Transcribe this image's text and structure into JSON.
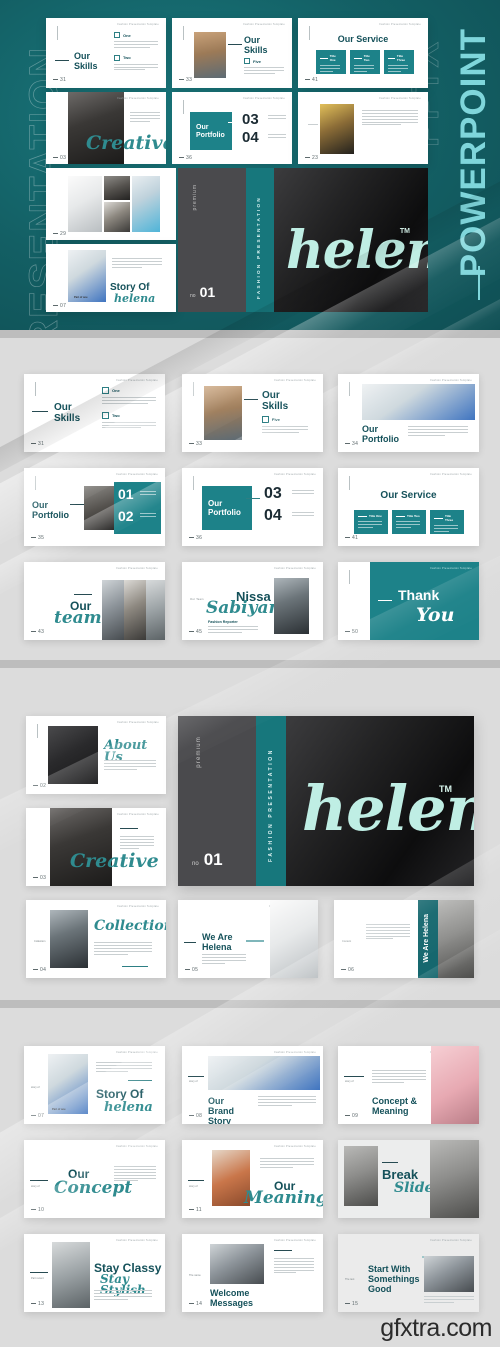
{
  "meta": {
    "watermark": "gfxtra.com",
    "accent_teal": "#1d8289",
    "deep_teal": "#156b70",
    "title_ink": "#15515a",
    "script_mint": "#bfeee4"
  },
  "hero_banner": {
    "vertical_left_outline": "PRESENTATION",
    "vertical_right_outline": "PPTX",
    "vertical_right_solid": "POWERPOINT",
    "slides": [
      {
        "id": "skills-a",
        "number": "31",
        "header": "Fashion Presentation Template",
        "title": "Our Skills",
        "items": [
          "One",
          "Two"
        ]
      },
      {
        "id": "skills-b",
        "number": "33",
        "header": "Fashion Presentation Template",
        "title": "Our Skills",
        "items": [
          "Five"
        ]
      },
      {
        "id": "service",
        "number": "41",
        "header": "Fashion Presentation Template",
        "title": "Our Service",
        "cards": [
          "Title One",
          "Title Two",
          "Title Three"
        ]
      },
      {
        "id": "creative",
        "number": "03",
        "header": "Fashion Presentation Template",
        "script": "Creative"
      },
      {
        "id": "portfolio-b",
        "number": "36",
        "header": "Fashion Presentation Template",
        "title": "Our Portfolio",
        "numbers": [
          "03",
          "04"
        ]
      },
      {
        "id": "yellow",
        "number": "23",
        "header": "Fashion Presentation Template"
      },
      {
        "id": "grid",
        "number": "29",
        "header": "Fashion Presentation Template"
      },
      {
        "id": "story",
        "number": "07",
        "header": "Fashion Presentation Template",
        "title": "Story Of",
        "script": "helena",
        "caption": "Part of one"
      }
    ],
    "cover": {
      "premium_label": "premium",
      "band_label": "FASHION PRESENTATION",
      "no_prefix": "no",
      "no_value": "01",
      "brand": "helena",
      "trademark": "TM"
    }
  },
  "section_2": {
    "slides": [
      {
        "number": "31",
        "header": "Fashion Presentation Template",
        "title": "Our Skills",
        "items": [
          "One",
          "Two"
        ]
      },
      {
        "number": "33",
        "header": "Fashion Presentation Template",
        "title": "Our Skills",
        "items": [
          "Five"
        ]
      },
      {
        "number": "34",
        "header": "Fashion Presentation Template",
        "title": "Our Portfolio"
      },
      {
        "number": "35",
        "header": "Fashion Presentation Template",
        "title": "Our Portfolio",
        "numbers": [
          "01",
          "02"
        ]
      },
      {
        "number": "36",
        "header": "Fashion Presentation Template",
        "title": "Our Portfolio",
        "numbers": [
          "03",
          "04"
        ]
      },
      {
        "number": "41",
        "header": "Fashion Presentation Template",
        "title": "Our Service",
        "cards": [
          "Title One",
          "Title Two",
          "Title Three"
        ]
      },
      {
        "number": "43",
        "header": "Fashion Presentation Template",
        "title": "Our",
        "script": "team",
        "kicker": "Our Team"
      },
      {
        "number": "45",
        "header": "Fashion Presentation Template",
        "title": "Nissa",
        "script": "Sabiyan",
        "subtitle": "Fashion Reporter",
        "kicker": "Our Team"
      },
      {
        "number": "50",
        "header": "Fashion Presentation Template",
        "title": "Thank",
        "script": "You"
      }
    ]
  },
  "section_3": {
    "slides": [
      {
        "number": "02",
        "header": "Fashion Presentation Template",
        "script": "About Us"
      },
      {
        "number": "03",
        "header": "Fashion Presentation Template",
        "script": "Creative"
      },
      {
        "number": "04",
        "header": "Fashion Presentation Template",
        "script": "Collection",
        "kicker": "Collection"
      },
      {
        "number": "05",
        "header": "Fashion Presentation Template",
        "title": "We Are Helena"
      },
      {
        "number": "06",
        "header": "Fashion Presentation Template",
        "title": "We Are Helena",
        "kicker": "Content"
      }
    ],
    "cover": {
      "premium_label": "premium",
      "band_label": "FASHION PRESENTATION",
      "no_prefix": "no",
      "no_value": "01",
      "brand": "helena",
      "trademark": "TM"
    }
  },
  "section_4": {
    "slides": [
      {
        "number": "07",
        "header": "Fashion Presentation Template",
        "title": "Story Of",
        "script": "helena",
        "kicker": "story of",
        "caption": "Part of one"
      },
      {
        "number": "08",
        "header": "Fashion Presentation Template",
        "title": "Our Brand Story",
        "kicker": "story of"
      },
      {
        "number": "09",
        "header": "Fashion Presentation Template",
        "title": "Concept & Meaning",
        "kicker": "story of"
      },
      {
        "number": "10",
        "header": "Fashion Presentation Template",
        "title": "Our",
        "script": "Concept",
        "kicker": "story of"
      },
      {
        "number": "11",
        "header": "Fashion Presentation Template",
        "title": "Our",
        "script": "Meaning",
        "kicker": "story of"
      },
      {
        "number": "12",
        "header": "Fashion Presentation Template",
        "title": "Break",
        "script": "Slide"
      },
      {
        "number": "13",
        "header": "Fashion Presentation Template",
        "title": "Stay Classy",
        "script": "Stay Stylish",
        "kicker": "Part recent"
      },
      {
        "number": "14",
        "header": "Fashion Presentation Template",
        "title": "Welcome Messages",
        "kicker": "The name"
      },
      {
        "number": "15",
        "header": "Fashion Presentation Template",
        "title": "Start With Somethings Good",
        "kicker": "The text"
      }
    ]
  }
}
